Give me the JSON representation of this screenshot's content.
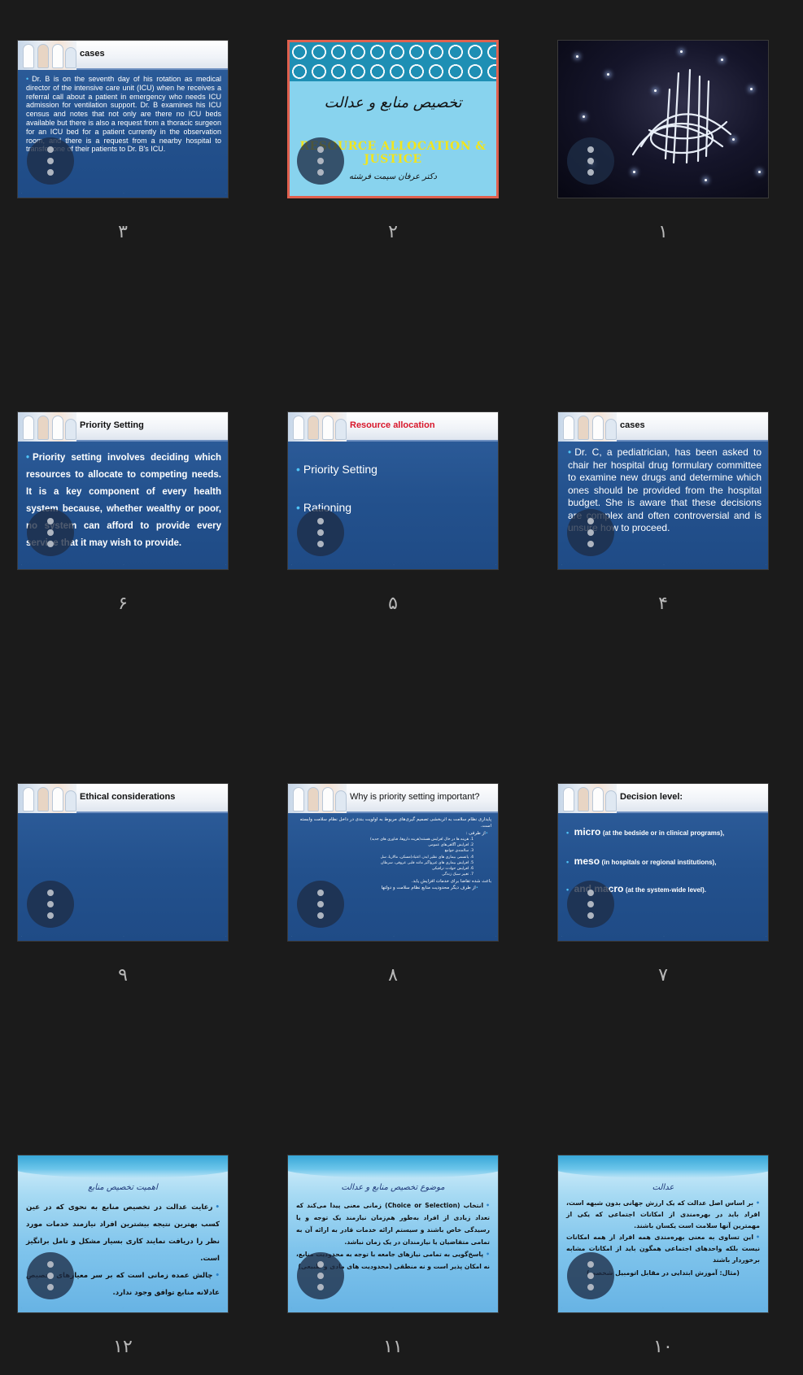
{
  "slides": {
    "s1": {
      "num": "۱"
    },
    "s2": {
      "num": "۲",
      "title_fa": "تخصیص منابع و عدالت",
      "title_en": "RESOURCE ALLOCATION & JUSTICE",
      "author": "دکتر عرفان سیمت فرشته"
    },
    "s3": {
      "num": "۳",
      "title": "cases",
      "body": "Dr. B is on the seventh day of his rotation as medical director of the intensive care unit (ICU) when he receives a referral call about a patient in emergency who needs ICU admission for ventilation support. Dr. B examines his ICU census and notes that not only are there no ICU beds available but there is also a request from a thoracic surgeon for an ICU bed for a patient currently in the observation room, and there is a request from a nearby hospital to transfer one of their patients to Dr. B's ICU."
    },
    "s4": {
      "num": "۴",
      "title": "cases",
      "body": "Dr. C, a pediatrician, has been asked to chair her hospital drug formulary committee to examine new drugs and determine which ones should be provided from the hospital budget. She is aware that these decisions are complex and often controversial and is unsure how to proceed."
    },
    "s5": {
      "num": "۵",
      "title": "Resource allocation",
      "items": [
        "Priority Setting",
        "Rationing"
      ]
    },
    "s6": {
      "num": "۶",
      "title": "Priority Setting",
      "body": "Priority setting involves deciding which resources to allocate to competing needs. It is a key component of every health system because, whether wealthy or poor, no system can afford to provide every service that it may wish to provide."
    },
    "s7": {
      "num": "۷",
      "title": "Decision level:",
      "items": [
        {
          "term": "micro",
          "desc": "(at the bedside or in clinical programs),"
        },
        {
          "term": "meso",
          "desc": "(in hospitals or regional institutions),"
        },
        {
          "term": "and macro",
          "desc": "(at the system-wide level)."
        }
      ]
    },
    "s8": {
      "num": "۸",
      "title": "Why is priority setting important?",
      "intro": "پایداری نظام سلامت به اثربخشی تصمیم گیری‌های مربوط به اولویت بندی در داخل نظام سلامت وابسته است.",
      "side": "از طرفی :",
      "list": [
        "1. هزینه ها در حال افزایش هستند(هزینه داروها، فناوری های جدید)",
        "2. افزایش آگاهی‌های عمومی",
        "3. سالمندی جوامع",
        "4. پانسمی بیماری های نظیر ایدز، اعتیاد(مسکن، مالاریا، سل",
        "5. افزایش بیماری های غیرواگیر مانند قلبی عروقی، سرطان",
        "6. افزایش حوادث ترافیکی",
        "7. تغییر سبک زندگی"
      ],
      "result": "باعث شده تقاضا برای خدمات افزایش یابد.",
      "other": "از طرف دیگر محدودیت منابع نظام سلامت و دولتها"
    },
    "s9": {
      "num": "۹",
      "title": "Ethical considerations"
    },
    "s10": {
      "num": "۱۰",
      "title": "عدالت",
      "p1": "بر اساس اصل عدالت که یک ارزش جهانی بدون شبهه است، افراد باید در بهره‌مندی از امکانات اجتماعی که یکی از مهمترین آنها سلامت است یکسان باشند.",
      "p2": "این تساوی به معنی بهره‌مندی همه افراد از همه امکانات نیست بلکه واحدهای اجتماعی همگون باید از امکانات مشابه برخوردار باشند",
      "p3": "(مثال: آموزش ابتدایی در مقابل اتومبیل شخصی)"
    },
    "s11": {
      "num": "۱۱",
      "title": "موضوع تخصیص منابع و عدالت",
      "p1": "انتخاب (Choice or Selection) زمانی معنی پیدا می‌کند که تعداد زیادی از افراد به‌طور هم‌زمان نیازمند یک توجه و یا رسیدگی خاص باشند و سیستم ارائه خدمات قادر به ارائه آن به تمامی متقاضیان یا نیازمندان در یک زمان نباشد.",
      "p2": "پاسخ‌گویی به تمامی نیازهای جامعه با توجه به محدودیت منابع، نه امکان پذیر است و نه منطقی (محدودیت های مادی و طبیعی)"
    },
    "s12": {
      "num": "۱۲",
      "title": "اهمیت تخصیص منابع",
      "p1": "رعایت عدالت در تخصیص منابع به نحوی که در عین کسب بهترین نتیجه بیشترین افراد نیازمند خدمات مورد نظر را دریافت نمایند کاری بسیار مشکل و تامل برانگیز است.",
      "p2": "چالش عمده زمانی است که بر سر معیارهای تخصیص عادلانه منابع توافق وجود ندارد."
    }
  }
}
